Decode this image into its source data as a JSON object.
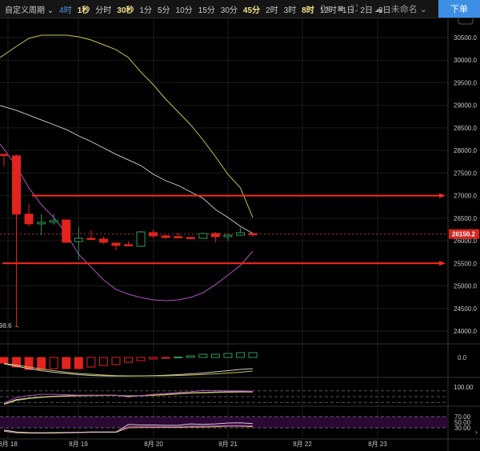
{
  "toolbar": {
    "custom_period": "自定义周期 ⌄",
    "periods": [
      {
        "label": "4时",
        "style": "blue"
      },
      {
        "label": "1秒",
        "style": "yellow"
      },
      {
        "label": "分时",
        "style": ""
      },
      {
        "label": "30秒",
        "style": "yellow"
      },
      {
        "label": "1分",
        "style": ""
      },
      {
        "label": "5分",
        "style": ""
      },
      {
        "label": "10分",
        "style": ""
      },
      {
        "label": "15分",
        "style": ""
      },
      {
        "label": "30分",
        "style": ""
      },
      {
        "label": "45分",
        "style": "yellow"
      },
      {
        "label": "2时",
        "style": ""
      },
      {
        "label": "3时",
        "style": ""
      },
      {
        "label": "8时",
        "style": "yellow"
      },
      {
        "label": "12时",
        "style": ""
      },
      {
        "label": "1日",
        "style": ""
      },
      {
        "label": "2日",
        "style": ""
      },
      {
        "label": "3日",
        "style": ""
      }
    ],
    "timer": "0s",
    "layout_name": "未命名 ⌄",
    "order_button": "下单",
    "icons": [
      "camera-icon",
      "fullscreen-icon",
      "cloud-upload-icon"
    ]
  },
  "colors": {
    "up": "#2f9a55",
    "down": "#e3231e",
    "accent": "#3d8fe6",
    "upper_band": "#c9c24a",
    "middle_band": "#bdbdbd",
    "lower_band": "#b04fc0",
    "hline": "#ff2a1a"
  },
  "chart_data": {
    "type": "candlestick",
    "x_labels": [
      "8月 18",
      "8月 19",
      "8月 20",
      "8月 21",
      "8月 22",
      "8月 23"
    ],
    "price_axis": {
      "ticks": [
        "30500.0",
        "30000.0",
        "29500.0",
        "29000.0",
        "28500.0",
        "28000.0",
        "27500.0",
        "27000.0",
        "26500.0",
        "26000.0",
        "25500.0",
        "25000.0",
        "24500.0",
        "24000.0"
      ],
      "range": [
        23850,
        30700
      ]
    },
    "last_price": "26150.2",
    "low_marker": "98.6 →",
    "horizontal_lines": [
      27000,
      25500
    ],
    "candles": [
      {
        "o": 27914,
        "h": 27914,
        "l": 27650,
        "c": 27900
      },
      {
        "o": 27880,
        "h": 27910,
        "l": 24100,
        "c": 26590
      },
      {
        "o": 26590,
        "h": 26816,
        "l": 26320,
        "c": 26375
      },
      {
        "o": 26375,
        "h": 26590,
        "l": 26125,
        "c": 26410
      },
      {
        "o": 26410,
        "h": 26590,
        "l": 26355,
        "c": 26445
      },
      {
        "o": 26460,
        "h": 26460,
        "l": 25966,
        "c": 25966
      },
      {
        "o": 25984,
        "h": 26303,
        "l": 25577,
        "c": 26055
      },
      {
        "o": 26055,
        "h": 26232,
        "l": 26020,
        "c": 26037
      },
      {
        "o": 26037,
        "h": 26090,
        "l": 25930,
        "c": 25966
      },
      {
        "o": 25949,
        "h": 25960,
        "l": 25789,
        "c": 25895
      },
      {
        "o": 25913,
        "h": 25984,
        "l": 25880,
        "c": 25895
      },
      {
        "o": 25878,
        "h": 26214,
        "l": 25860,
        "c": 26196
      },
      {
        "o": 26180,
        "h": 26250,
        "l": 26055,
        "c": 26108
      },
      {
        "o": 26108,
        "h": 26125,
        "l": 26040,
        "c": 26073
      },
      {
        "o": 26090,
        "h": 26180,
        "l": 26073,
        "c": 26073
      },
      {
        "o": 26073,
        "h": 26090,
        "l": 26040,
        "c": 26055
      },
      {
        "o": 26055,
        "h": 26180,
        "l": 26050,
        "c": 26160
      },
      {
        "o": 26160,
        "h": 26196,
        "l": 25966,
        "c": 26090
      },
      {
        "o": 26090,
        "h": 26140,
        "l": 26000,
        "c": 26125
      },
      {
        "o": 26125,
        "h": 26285,
        "l": 26110,
        "c": 26180
      },
      {
        "o": 26160,
        "h": 26170,
        "l": 26090,
        "c": 26150.2
      }
    ],
    "bollinger": {
      "upper": [
        30057,
        30305,
        30482,
        30553,
        30553,
        30553,
        30518,
        30447,
        30341,
        30234,
        30057,
        29738,
        29455,
        29136,
        28853,
        28570,
        28233,
        27861,
        27472,
        27171,
        26516
      ],
      "middle": [
        28995,
        28888,
        28782,
        28676,
        28570,
        28463,
        28322,
        28198,
        28056,
        27914,
        27790,
        27666,
        27472,
        27330,
        27224,
        27082,
        26940,
        26692,
        26516,
        26321,
        26161
      ],
      "lower": [
        28145,
        27649,
        27171,
        26799,
        26516,
        26162,
        25701,
        25417,
        25134,
        24922,
        24815,
        24744,
        24691,
        24673,
        24691,
        24744,
        24850,
        25028,
        25240,
        25453,
        25771
      ]
    },
    "macd": {
      "zero_label": "0.0",
      "hist": [
        -140,
        -240,
        -300,
        -300,
        -280,
        -280,
        -280,
        -240,
        -200,
        -180,
        -120,
        -80,
        -40,
        -10,
        10,
        40,
        80,
        80,
        100,
        120,
        120
      ],
      "dif": [
        -160,
        -220,
        -280,
        -330,
        -370,
        -400,
        -430,
        -450,
        -460,
        -465,
        -465,
        -460,
        -455,
        -445,
        -430,
        -410,
        -390,
        -360,
        -330,
        -300,
        -280
      ],
      "dea": [
        -150,
        -190,
        -240,
        -290,
        -330,
        -370,
        -400,
        -420,
        -440,
        -455,
        -460,
        -462,
        -460,
        -458,
        -450,
        -440,
        -425,
        -410,
        -390,
        -370,
        -340
      ]
    },
    "kdj": {
      "label": "100.00",
      "levels": [
        80,
        50,
        20
      ],
      "k": [
        17,
        46,
        55,
        62,
        62,
        60,
        58,
        58,
        58,
        58,
        48,
        55,
        62,
        66,
        72,
        75,
        83,
        82,
        80,
        80,
        78
      ],
      "d": [
        12,
        35,
        42,
        48,
        52,
        54,
        56,
        56,
        57,
        57,
        52,
        54,
        58,
        62,
        66,
        70,
        72,
        74,
        75,
        76,
        76
      ],
      "j": [
        10,
        30,
        40,
        46,
        50,
        52,
        54,
        55,
        56,
        56,
        54,
        55,
        57,
        60,
        64,
        68,
        70,
        72,
        73,
        74,
        74
      ]
    },
    "rsi": {
      "labels": [
        "70.00",
        "50.00",
        "30.00"
      ],
      "levels": [
        70,
        50,
        30
      ],
      "r1": [
        22,
        15,
        13,
        12,
        13,
        13,
        14,
        15,
        15,
        15,
        42,
        40,
        40,
        39,
        39,
        44,
        42,
        44,
        47,
        48,
        45
      ],
      "r2": [
        18,
        12,
        11,
        11,
        11,
        12,
        13,
        14,
        14,
        14,
        30,
        31,
        31,
        31,
        31,
        33,
        33,
        34,
        36,
        36,
        34
      ],
      "r3": [
        20,
        14,
        13,
        13,
        13,
        14,
        14,
        15,
        15,
        15,
        34,
        34,
        34,
        34,
        34,
        36,
        36,
        37,
        38,
        38,
        37
      ]
    }
  }
}
